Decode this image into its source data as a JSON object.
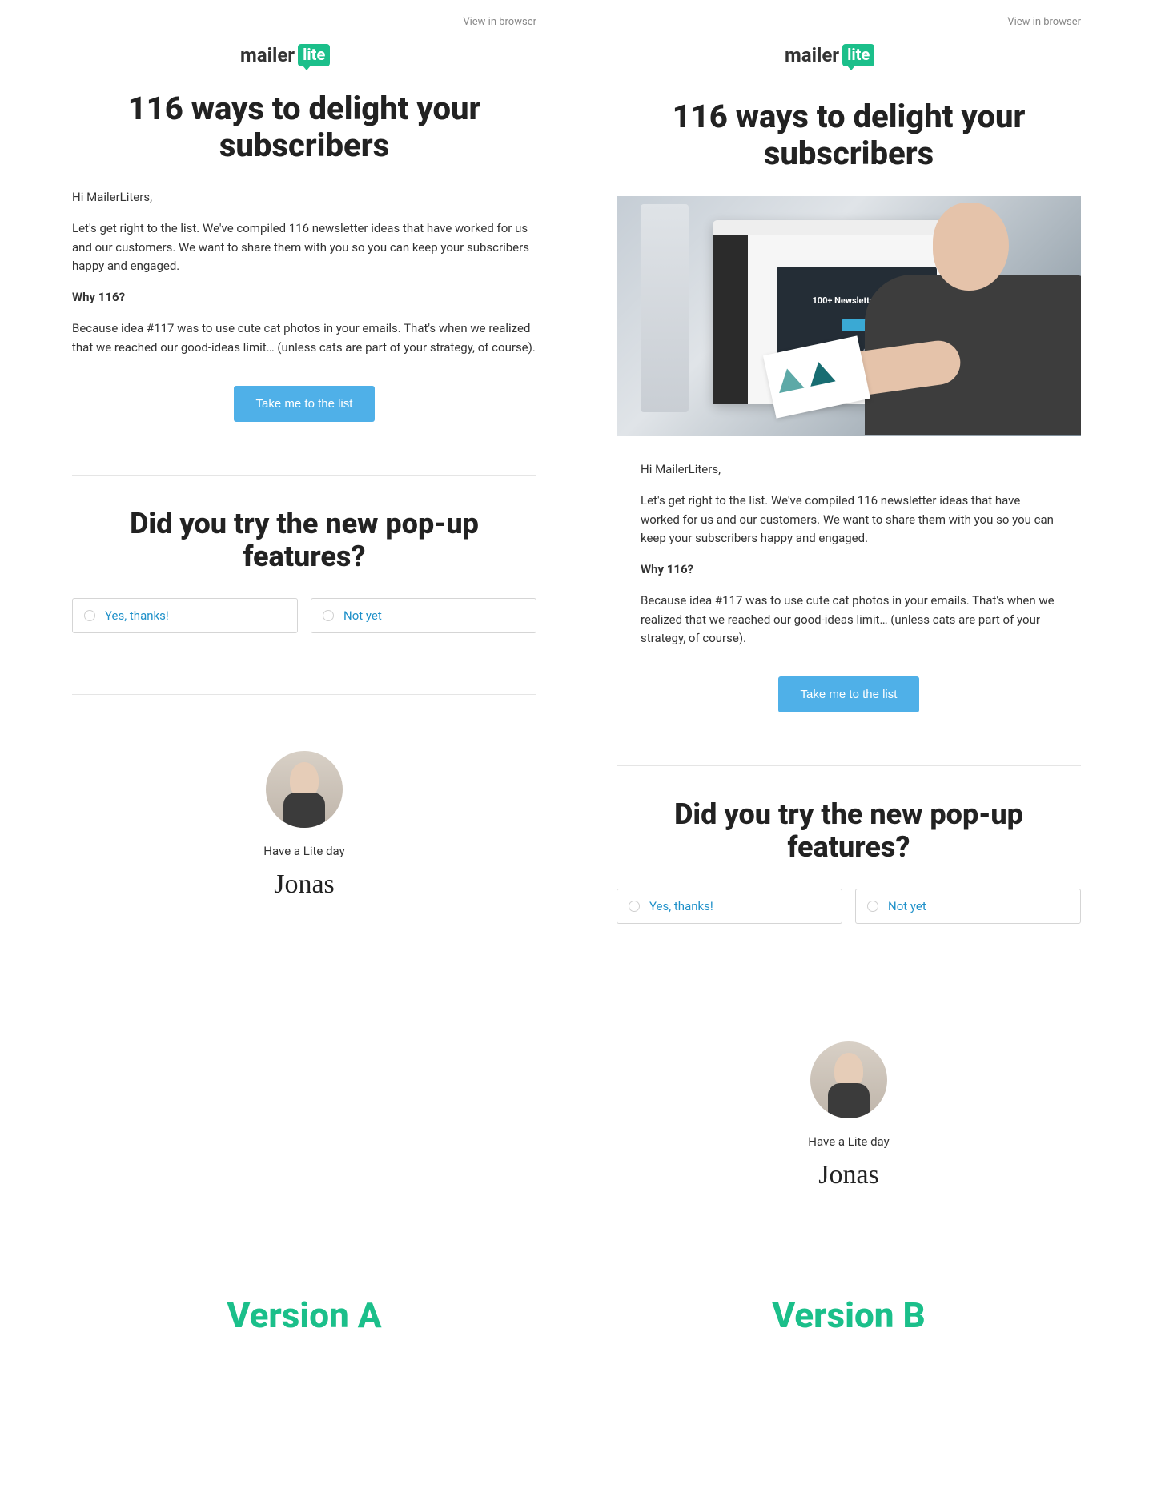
{
  "viewInBrowser": "View in browser",
  "logo": {
    "text1": "mailer",
    "text2": "lite"
  },
  "headline": "116 ways to delight your subscribers",
  "greeting": "Hi MailerLiters,",
  "intro": "Let's get right to the list. We've compiled 116 newsletter ideas that have worked for us and our customers. We want to share them with you so you can keep your subscribers happy and engaged.",
  "whyLabel": "Why 116?",
  "whyBody": "Because idea #117 was to use cute cat photos in your emails. That's when we realized that we reached our good-ideas limit… (unless cats are part of your strategy, of course).",
  "ctaLabel": "Take me to the list",
  "survey": {
    "question": "Did you try the new pop-up features?",
    "optYes": "Yes, thanks!",
    "optNo": "Not yet"
  },
  "signoff": "Have a Lite day",
  "signature": "Jonas",
  "heroPanelTitle": "100+ Newsletter Ideas",
  "versions": {
    "a": "Version A",
    "b": "Version B"
  }
}
